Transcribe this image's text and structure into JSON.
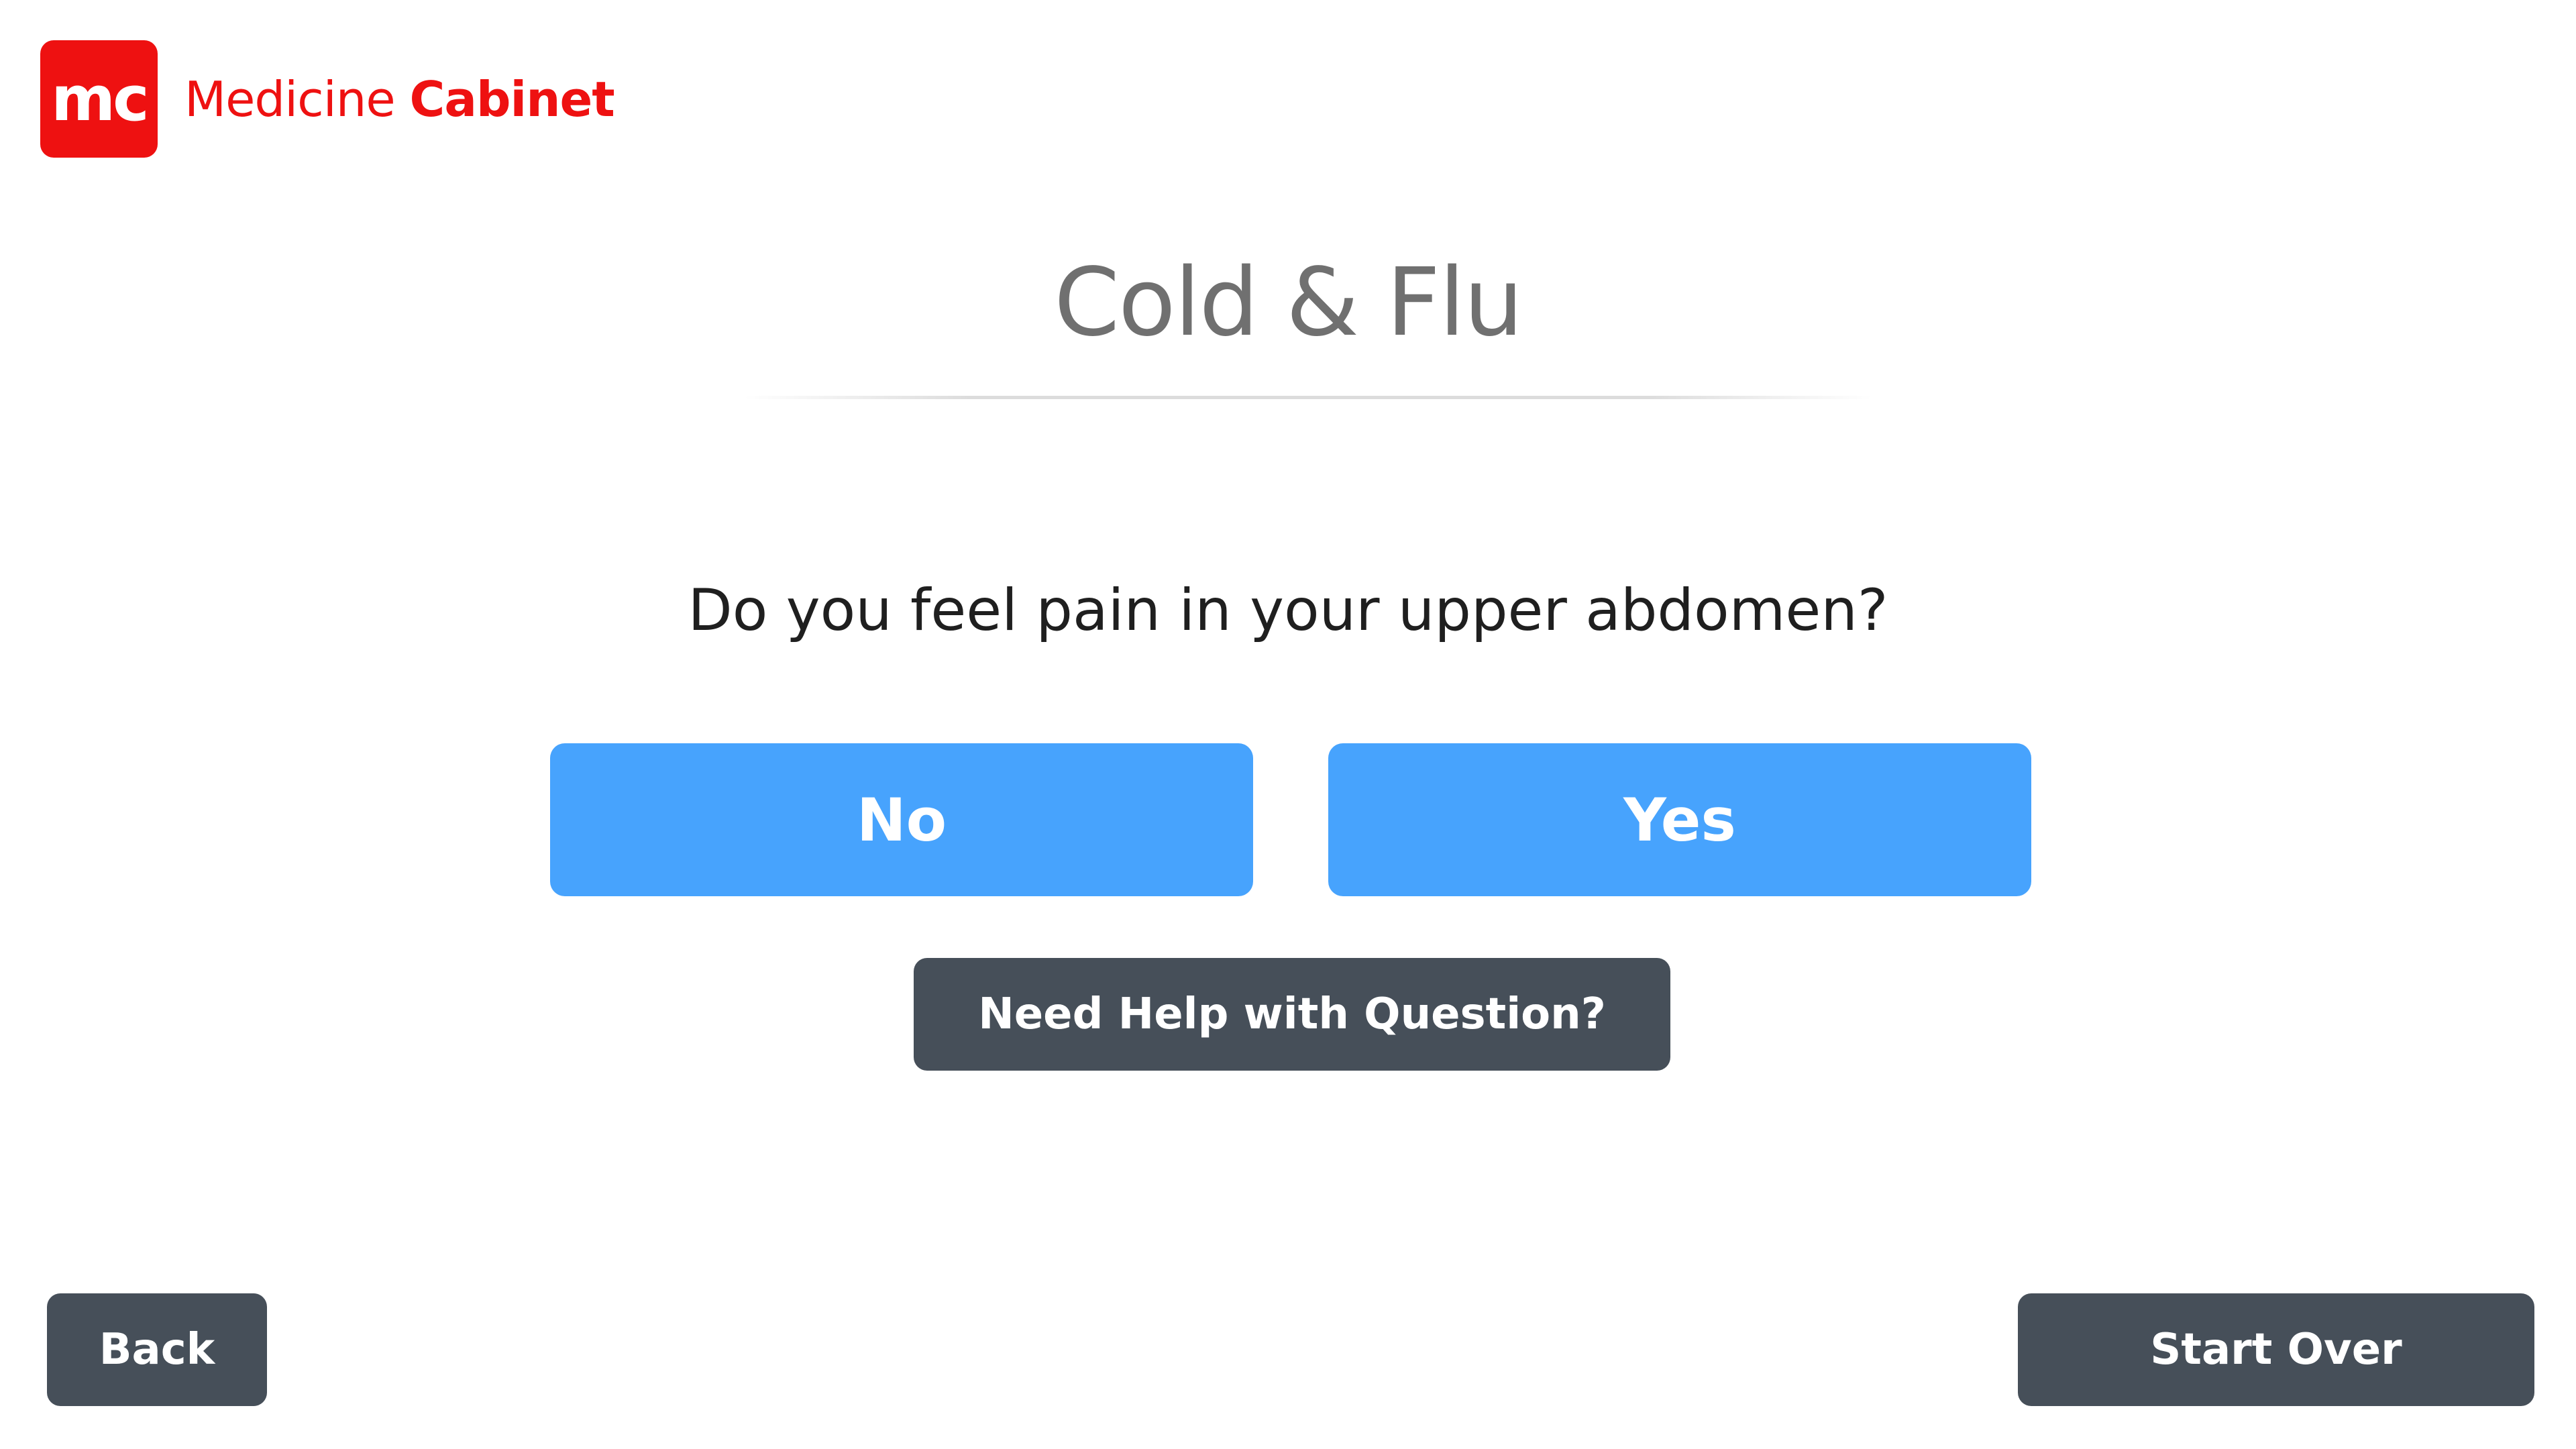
{
  "brand": {
    "logo_text": "mc",
    "name_regular": "Medicine",
    "name_bold": "Cabinet",
    "color": "#ee1111"
  },
  "header": {
    "title": "Cold & Flu"
  },
  "question": {
    "text": "Do you feel pain in your upper abdomen?"
  },
  "answers": {
    "no_label": "No",
    "yes_label": "Yes",
    "color": "#47a3fd"
  },
  "help": {
    "label": "Need Help with Question?"
  },
  "footer": {
    "back_label": "Back",
    "start_over_label": "Start Over",
    "color": "#464f59"
  }
}
